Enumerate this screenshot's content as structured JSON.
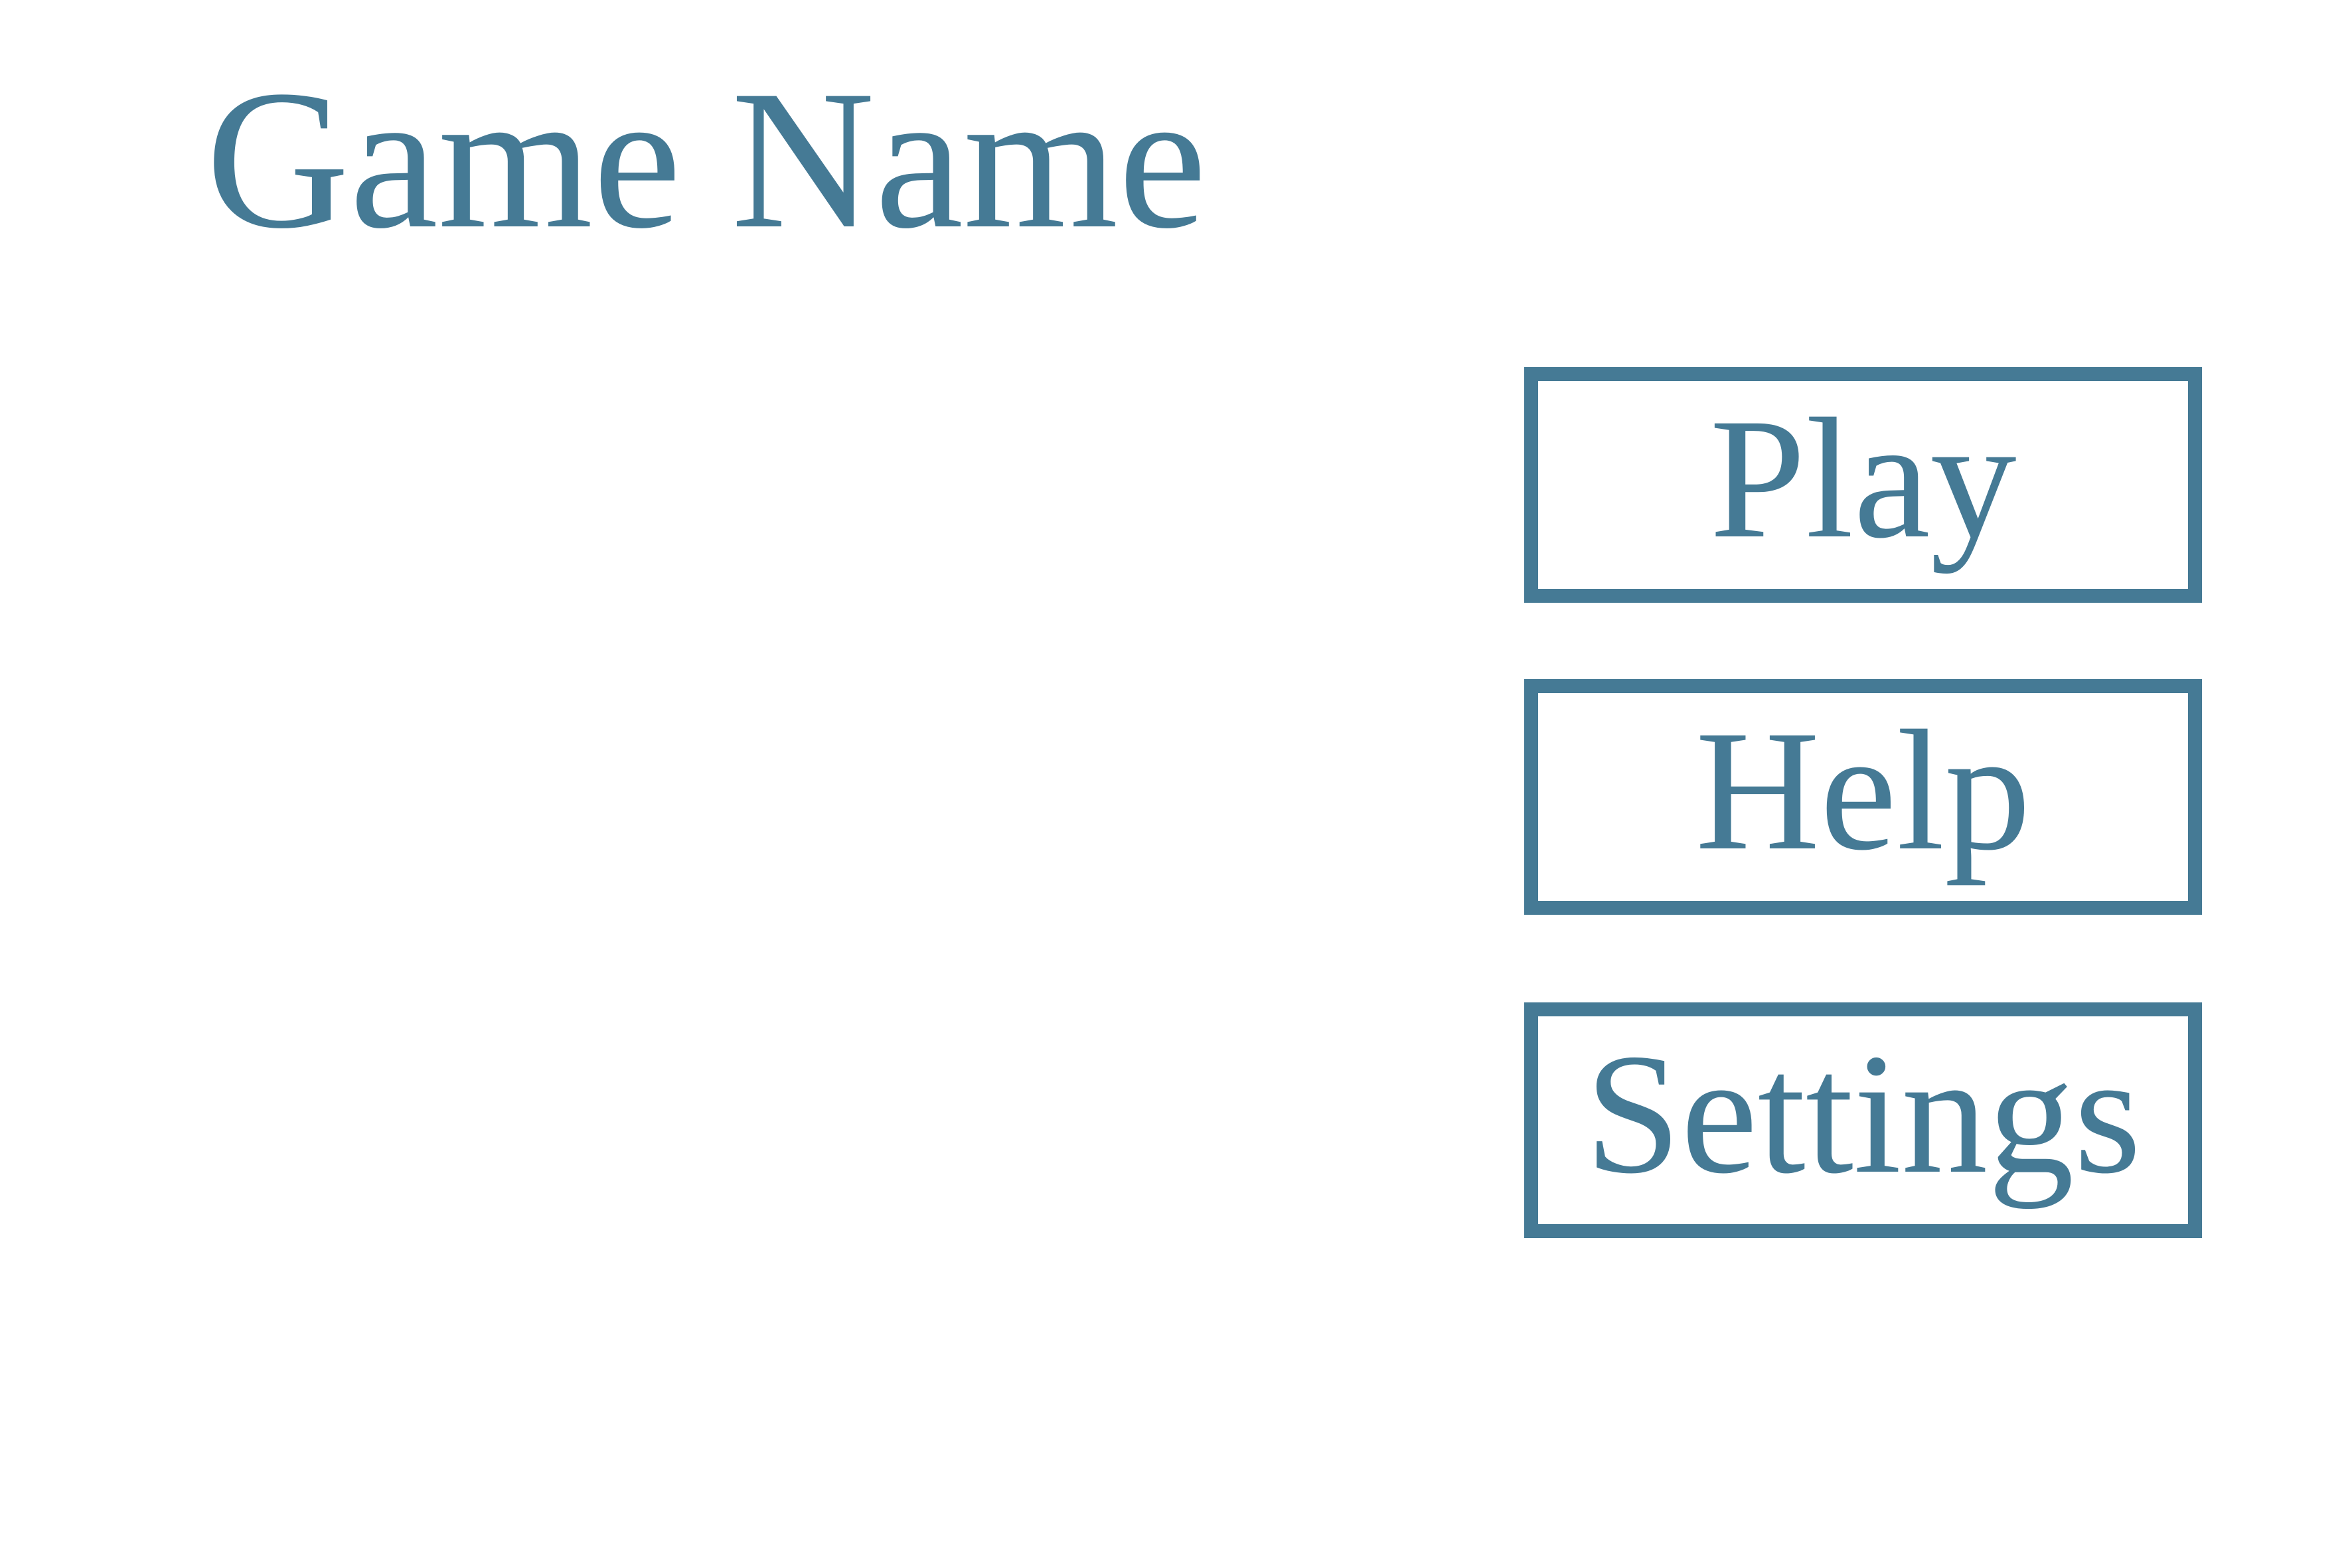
{
  "title": "Game Name",
  "menu": {
    "play_label": "Play",
    "help_label": "Help",
    "settings_label": "Settings"
  },
  "colors": {
    "accent": "#457a95",
    "background": "#ffffff"
  }
}
